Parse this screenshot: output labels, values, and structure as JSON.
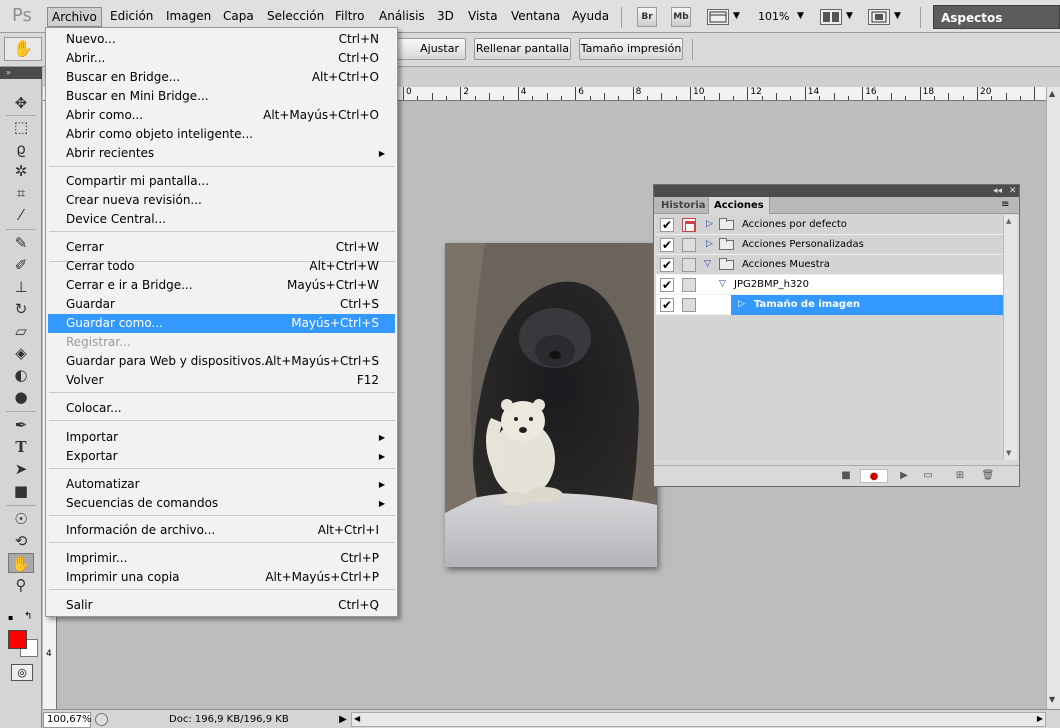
{
  "app": {
    "logo": "Ps"
  },
  "menubar": {
    "items": [
      "Archivo",
      "Edición",
      "Imagen",
      "Capa",
      "Selección",
      "Filtro",
      "Análisis",
      "3D",
      "Vista",
      "Ventana",
      "Ayuda"
    ],
    "bridge_label": "Br",
    "minibridge_label": "Mb",
    "zoom": "101%",
    "workspace": "Aspectos esenciales"
  },
  "options_bar": {
    "tool_icon": "hand-icon",
    "buttons": [
      "Ajustar pantalla",
      "Rellenar pantalla",
      "Tamaño impresión"
    ]
  },
  "menu": {
    "items": [
      {
        "label": "Nuevo...",
        "shortcut": "Ctrl+N"
      },
      {
        "label": "Abrir...",
        "shortcut": "Ctrl+O"
      },
      {
        "label": "Buscar en Bridge...",
        "shortcut": "Alt+Ctrl+O"
      },
      {
        "label": "Buscar en Mini Bridge...",
        "shortcut": ""
      },
      {
        "label": "Abrir como...",
        "shortcut": "Alt+Mayús+Ctrl+O"
      },
      {
        "label": "Abrir como objeto inteligente...",
        "shortcut": ""
      },
      {
        "label": "Abrir recientes",
        "shortcut": "",
        "submenu": true
      },
      {
        "label": "Compartir mi pantalla...",
        "shortcut": ""
      },
      {
        "label": "Crear nueva revisión...",
        "shortcut": ""
      },
      {
        "label": "Device Central...",
        "shortcut": ""
      },
      {
        "label": "Cerrar",
        "shortcut": "Ctrl+W"
      },
      {
        "label": "Cerrar todo",
        "shortcut": "Alt+Ctrl+W"
      },
      {
        "label": "Cerrar e ir a Bridge...",
        "shortcut": "Mayús+Ctrl+W"
      },
      {
        "label": "Guardar",
        "shortcut": "Ctrl+S"
      },
      {
        "label": "Guardar como...",
        "shortcut": "Mayús+Ctrl+S",
        "highlighted": true
      },
      {
        "label": "Registrar...",
        "shortcut": "",
        "disabled": true
      },
      {
        "label": "Guardar para Web y dispositivos...",
        "shortcut": "Alt+Mayús+Ctrl+S"
      },
      {
        "label": "Volver",
        "shortcut": "F12"
      },
      {
        "label": "Colocar...",
        "shortcut": ""
      },
      {
        "label": "Importar",
        "shortcut": "",
        "submenu": true
      },
      {
        "label": "Exportar",
        "shortcut": "",
        "submenu": true
      },
      {
        "label": "Automatizar",
        "shortcut": "",
        "submenu": true
      },
      {
        "label": "Secuencias de comandos",
        "shortcut": "",
        "submenu": true
      },
      {
        "label": "Información de archivo...",
        "shortcut": "Alt+Ctrl+I"
      },
      {
        "label": "Imprimir...",
        "shortcut": "Ctrl+P"
      },
      {
        "label": "Imprimir una copia",
        "shortcut": "Alt+Mayús+Ctrl+P"
      },
      {
        "label": "Salir",
        "shortcut": "Ctrl+Q"
      }
    ]
  },
  "ruler": {
    "h_labels": [
      "0",
      "2",
      "4",
      "6",
      "8",
      "10",
      "12",
      "14",
      "16",
      "18",
      "20"
    ],
    "v_labels": [
      "4"
    ]
  },
  "panel": {
    "tabs": [
      "Historia",
      "Acciones"
    ],
    "active_tab": "Acciones",
    "rows": [
      {
        "label": "Acciones por defecto",
        "checked": true,
        "dialog": true,
        "expanded": false
      },
      {
        "label": "Acciones Personalizadas",
        "checked": true,
        "dialog": false,
        "expanded": false
      },
      {
        "label": "Acciones Muestra",
        "checked": true,
        "dialog": false,
        "expanded": true
      },
      {
        "label": "JPG2BMP_h320",
        "checked": true,
        "dialog": false,
        "expanded": true
      },
      {
        "label": "Tamaño de imagen",
        "checked": true,
        "dialog": false,
        "selected": true
      }
    ]
  },
  "status": {
    "zoom": "100,67%",
    "doc": "Doc: 196,9 KB/196,9 KB"
  },
  "colors": {
    "foreground": "#ff0000",
    "background": "#ffffff",
    "highlight": "#3399ff"
  }
}
